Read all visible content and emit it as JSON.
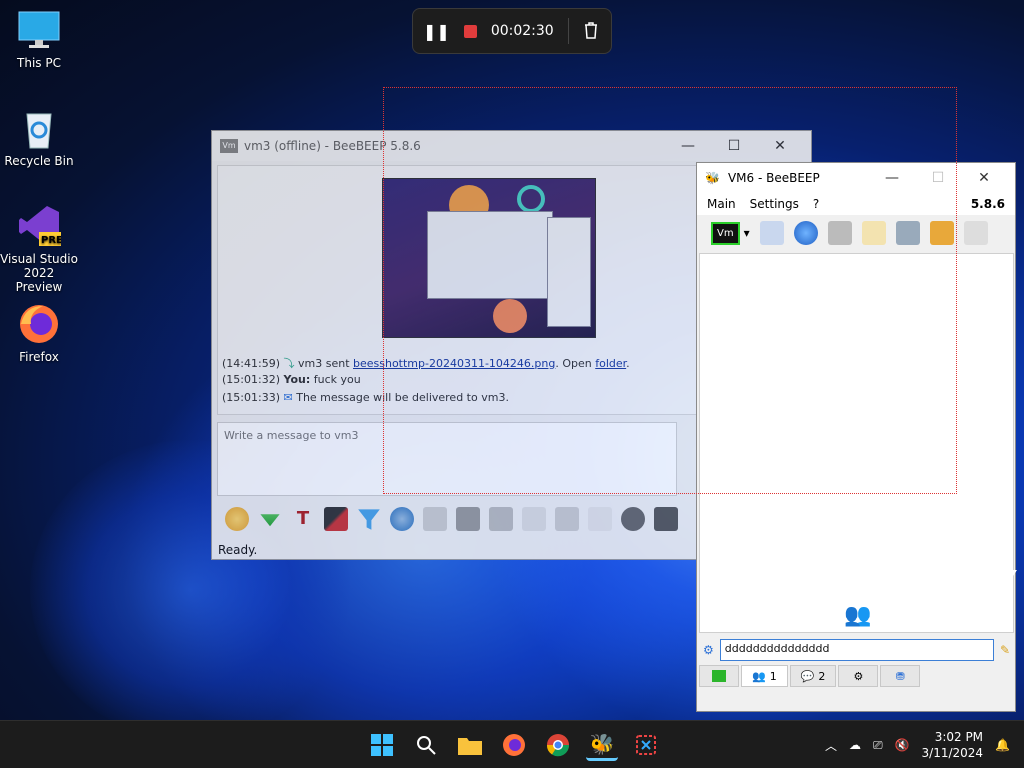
{
  "desktop": {
    "icons": [
      {
        "label": "This PC",
        "icon": "monitor-icon"
      },
      {
        "label": "Recycle Bin",
        "icon": "recycle-bin-icon"
      },
      {
        "label": "Visual Studio 2022 Preview",
        "icon": "visual-studio-icon"
      },
      {
        "label": "Firefox",
        "icon": "firefox-icon"
      }
    ]
  },
  "recording": {
    "time": "00:02:30"
  },
  "vm3_window": {
    "title": "vm3 (offline) - BeeBEEP 5.8.6",
    "chat": [
      {
        "time": "(14:41:59)",
        "text_before": "vm3 sent ",
        "link": "beesshottmp-20240311-104246.png",
        "text_mid": ". Open ",
        "link2": "folder",
        "text_after": "."
      },
      {
        "time": "(15:01:32)",
        "who": "You:",
        "text": "fuck you"
      },
      {
        "time": "(15:01:33)",
        "text": "The message will be delivered to vm3."
      }
    ],
    "input_placeholder": "Write a message to vm3",
    "status": "Ready."
  },
  "vm6_window": {
    "title": "VM6 - BeeBEEP",
    "menu": [
      "Main",
      "Settings",
      "?"
    ],
    "version": "5.8.6",
    "status_label": "Vm",
    "search_value": "ddddddddddddddd",
    "tabs": [
      {
        "label": "",
        "icon": "chat-list-icon"
      },
      {
        "label": "1",
        "icon": "users-icon"
      },
      {
        "label": "2",
        "icon": "chats-icon"
      },
      {
        "label": "",
        "icon": "groups-icon"
      },
      {
        "label": "",
        "icon": "shares-icon"
      }
    ]
  },
  "taskbar": {
    "clock_time": "3:02 PM",
    "clock_date": "3/11/2024"
  },
  "colors": {
    "accent": "#1f6bff",
    "taskbar": "#1c1c1c",
    "selection": "#dd3333"
  }
}
